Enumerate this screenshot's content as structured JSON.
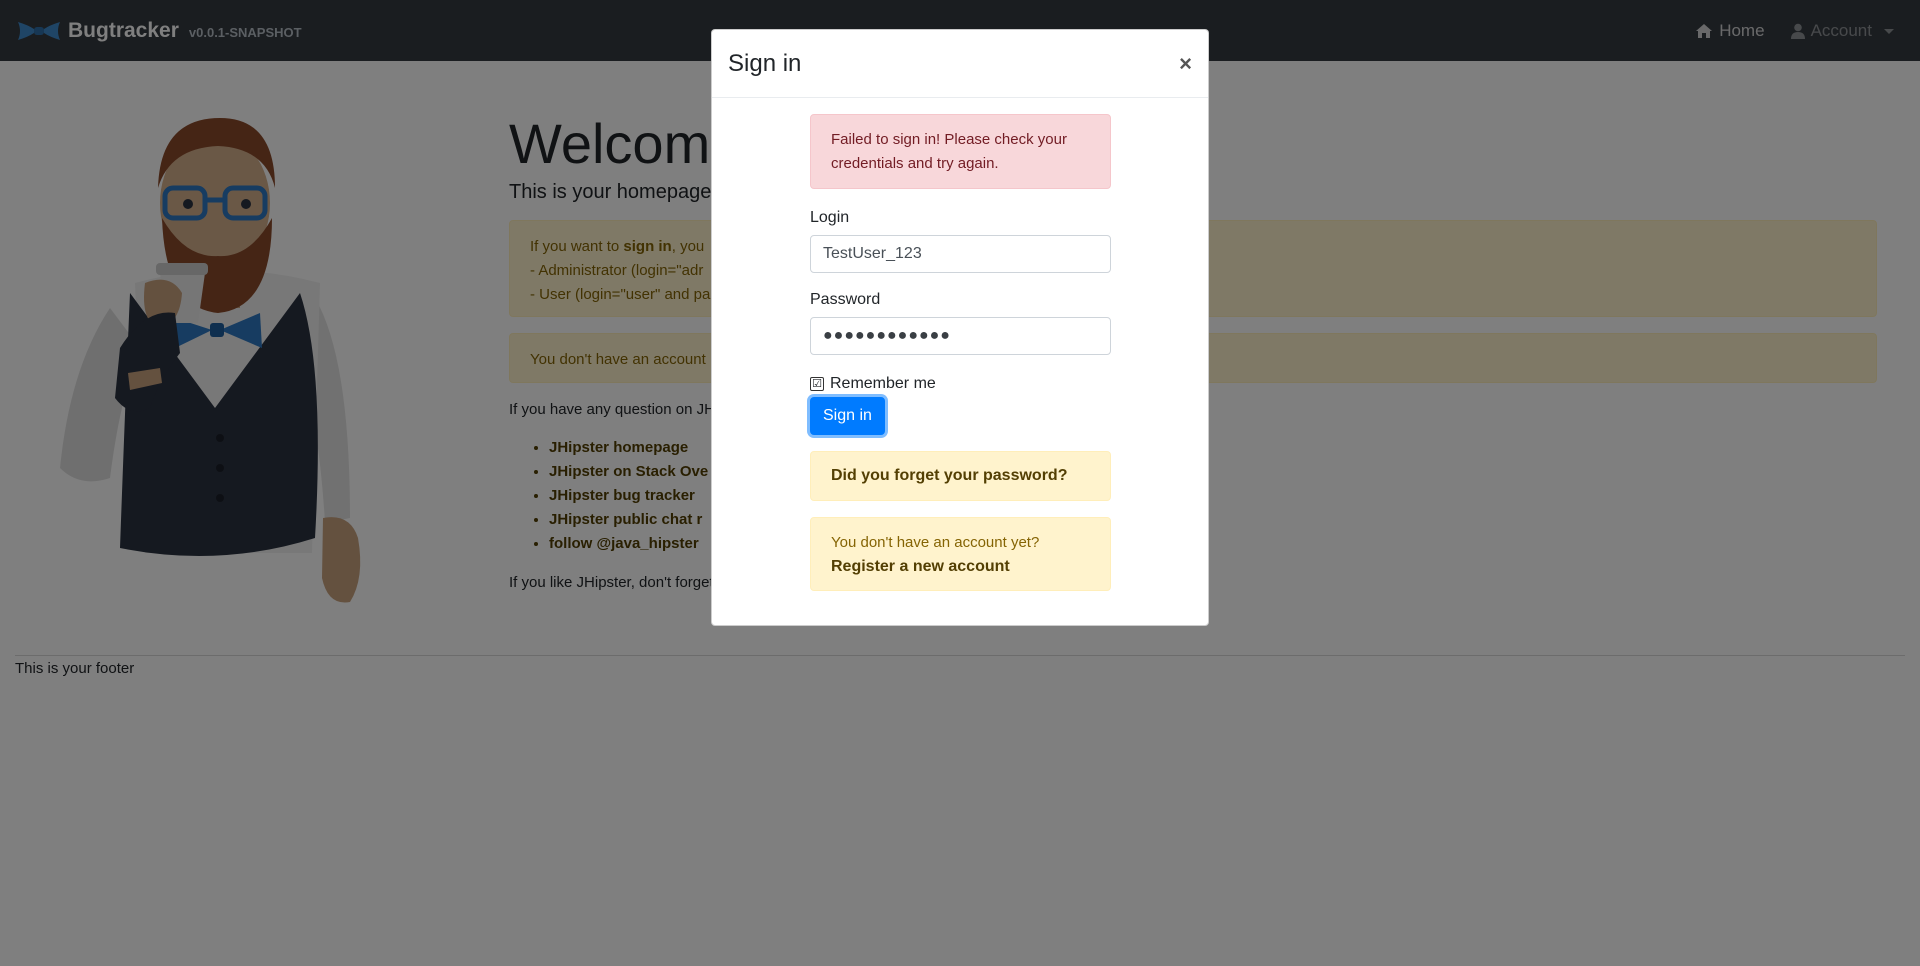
{
  "navbar": {
    "brand_name": "Bugtracker",
    "brand_version": "v0.0.1-SNAPSHOT",
    "home_label": "Home",
    "account_label": "Account",
    "home_icon": "home-icon",
    "account_icon": "user-icon"
  },
  "page": {
    "welcome": "Welcome",
    "lead": "This is your homepage",
    "alert1": {
      "line1_prefix": "If you want to ",
      "line1_bold": "sign in",
      "line1_suffix": ", you",
      "line2": "- Administrator (login=\"adr",
      "line3": "- User (login=\"user\" and pa"
    },
    "alert2": "You don't have an account",
    "question": "If you have any question on JH",
    "links": [
      "JHipster homepage",
      "JHipster on Stack Ove",
      "JHipster bug tracker",
      "JHipster public chat r",
      "follow @java_hipster"
    ],
    "like": "If you like JHipster, don't forget",
    "footer": "This is your footer"
  },
  "modal": {
    "title": "Sign in",
    "close": "×",
    "error_bold": "Failed to sign in!",
    "error_text": " Please check your credentials and try again.",
    "login_label": "Login",
    "login_value": "TestUser_123",
    "password_label": "Password",
    "password_value": "●●●●●●●●●●●●",
    "remember_label": "Remember me",
    "remember_checked": "☑",
    "signin_button": "Sign in",
    "forgot_link": "Did you forget your password?",
    "no_account": "You don't have an account yet?",
    "register_link": "Register a new account"
  },
  "colors": {
    "navbar": "#343a40",
    "primary": "#007bff",
    "danger_bg": "#f8d7da",
    "warning_bg": "#fff3cd"
  }
}
